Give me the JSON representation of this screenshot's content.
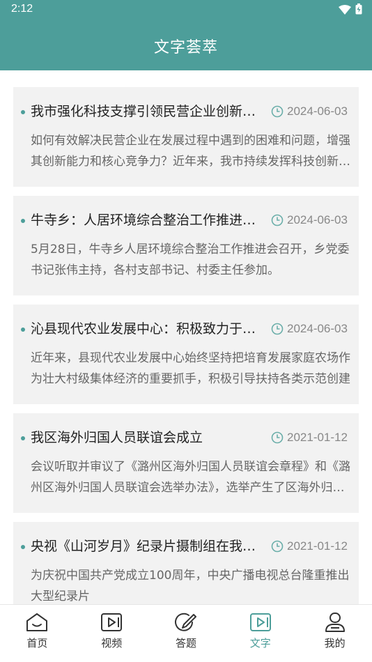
{
  "status_bar": {
    "time": "2:12"
  },
  "header": {
    "title": "文字荟萃"
  },
  "articles": [
    {
      "title": "我市强化科技支撑引领民营企业创新发展",
      "date": "2024-06-03",
      "summary": "如何有效解决民营企业在发展过程中遇到的困难和问题，增强其创新能力和核心竞争力？近年来，我市持续发挥科技创新的支撑引领作用"
    },
    {
      "title": "牛寺乡：人居环境综合整治工作推进会召开",
      "date": "2024-06-03",
      "summary": "5月28日，牛寺乡人居环境综合整治工作推进会召开，乡党委书记张伟主持，各村支部书记、村委主任参加。"
    },
    {
      "title": "沁县现代农业发展中心：积极致力于家庭农场培育",
      "date": "2024-06-03",
      "summary": "近年来，县现代农业发展中心始终坚持把培育发展家庭农场作为壮大村级集体经济的重要抓手，积极引导扶持各类示范创建"
    },
    {
      "title": "我区海外归国人员联谊会成立",
      "date": "2021-01-12",
      "summary": "会议听取并审议了《潞州区海外归国人员联谊会章程》和《潞州区海外归国人员联谊会选举办法》，选举产生了区海外归国人员联谊会领导班子"
    },
    {
      "title": "央视《山河岁月》纪录片摄制组在我区拍摄",
      "date": "2021-01-12",
      "summary": "为庆祝中国共产党成立100周年，中央广播电视总台隆重推出大型纪录片"
    }
  ],
  "tabbar": {
    "items": [
      {
        "label": "首页",
        "icon": "home-icon"
      },
      {
        "label": "视频",
        "icon": "video-icon"
      },
      {
        "label": "答题",
        "icon": "pencil-icon"
      },
      {
        "label": "文字",
        "icon": "text-play-icon",
        "active": true
      },
      {
        "label": "我的",
        "icon": "user-icon"
      }
    ]
  },
  "colors": {
    "accent": "#4d9e9a",
    "card_bg": "#f2f2f2"
  }
}
